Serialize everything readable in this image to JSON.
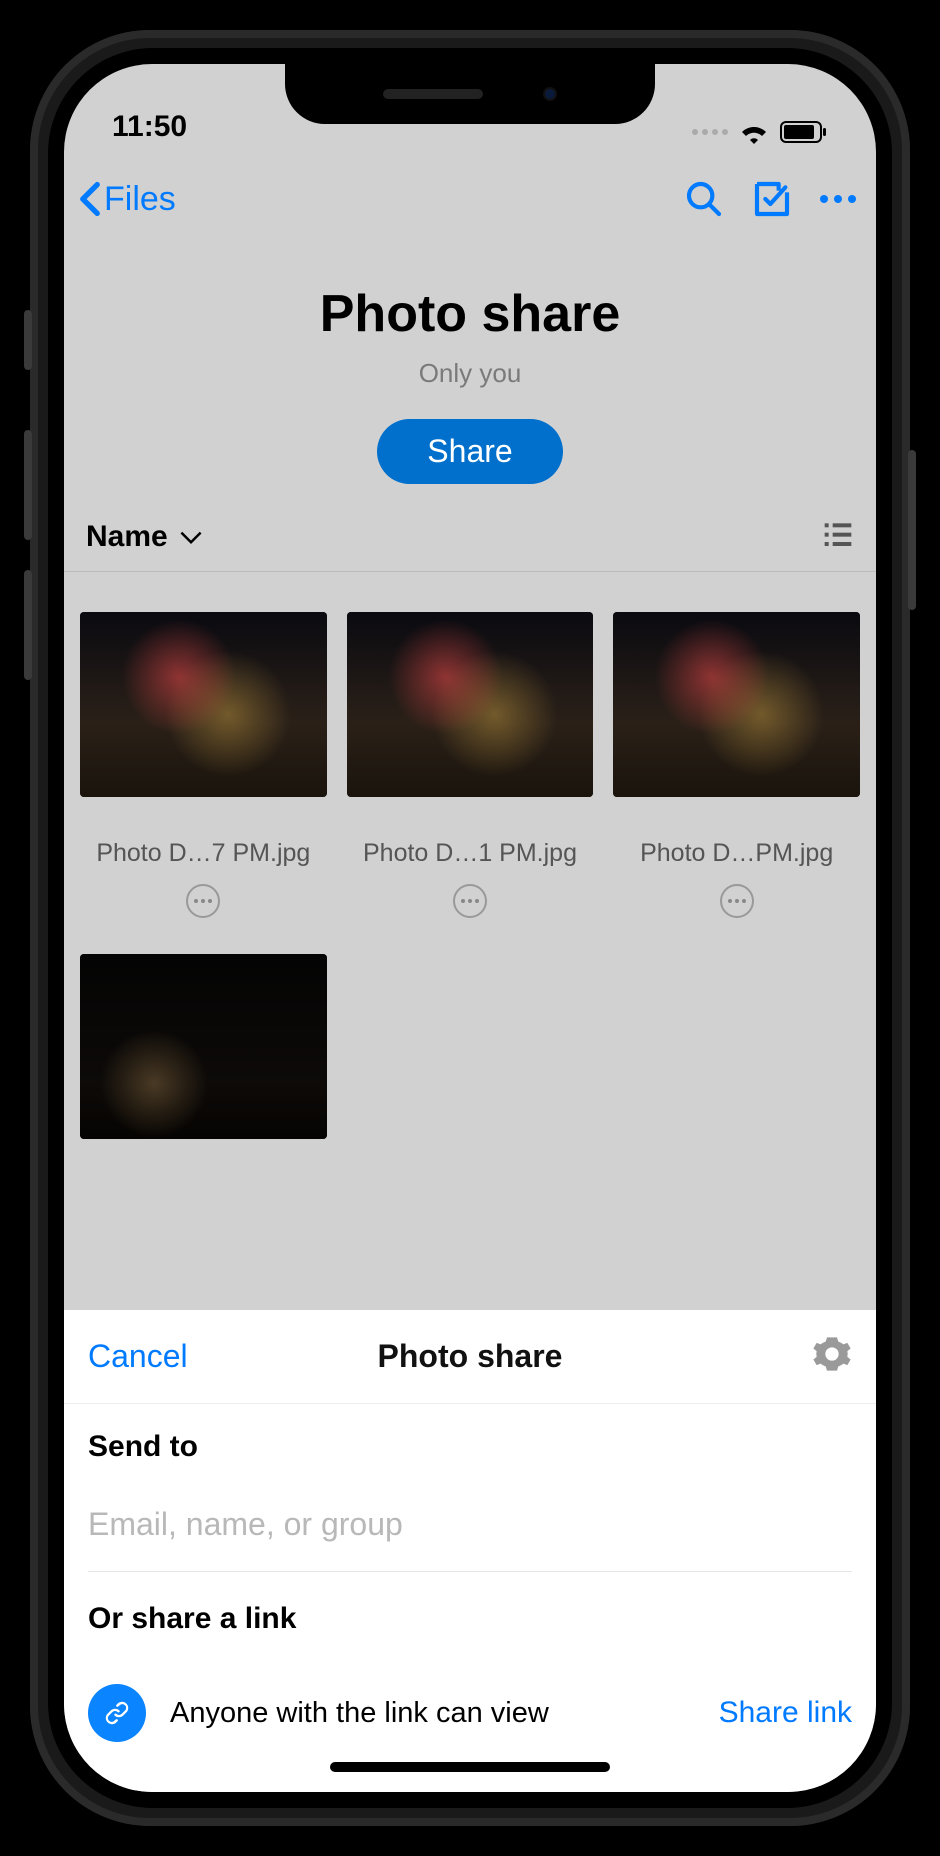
{
  "status": {
    "time": "11:50"
  },
  "nav": {
    "back_label": "Files"
  },
  "page": {
    "title": "Photo share",
    "subtitle": "Only you",
    "share_button": "Share"
  },
  "sort": {
    "label": "Name"
  },
  "files": [
    {
      "name": "Photo D…7 PM.jpg"
    },
    {
      "name": "Photo D…1 PM.jpg"
    },
    {
      "name": "Photo D…PM.jpg"
    },
    {
      "name": ""
    }
  ],
  "sheet": {
    "cancel": "Cancel",
    "title": "Photo share",
    "send_to_label": "Send to",
    "input_placeholder": "Email, name, or group",
    "or_label": "Or share a link",
    "link_desc": "Anyone with the link can view",
    "share_link": "Share link"
  }
}
